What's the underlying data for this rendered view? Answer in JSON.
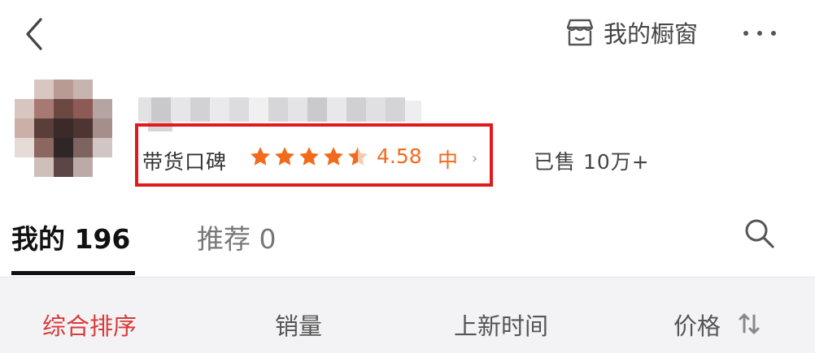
{
  "header": {
    "shop_window_label": "我的橱窗"
  },
  "profile": {
    "reputation_label": "带货口碑",
    "rating": 4.58,
    "rating_text": "4.58",
    "rating_level": "中",
    "chevron": "›",
    "sold_label": "已售 10万+",
    "stars_filled": 4.5
  },
  "tabs": {
    "mine_label": "我的 196",
    "recommended_label": "推荐 0"
  },
  "sort": {
    "items": [
      "综合排序",
      "销量",
      "上新时间",
      "价格"
    ]
  },
  "colors": {
    "accent_red": "#d93a3a",
    "highlight_box": "#e11b1b",
    "star_orange": "#f26a1b"
  }
}
